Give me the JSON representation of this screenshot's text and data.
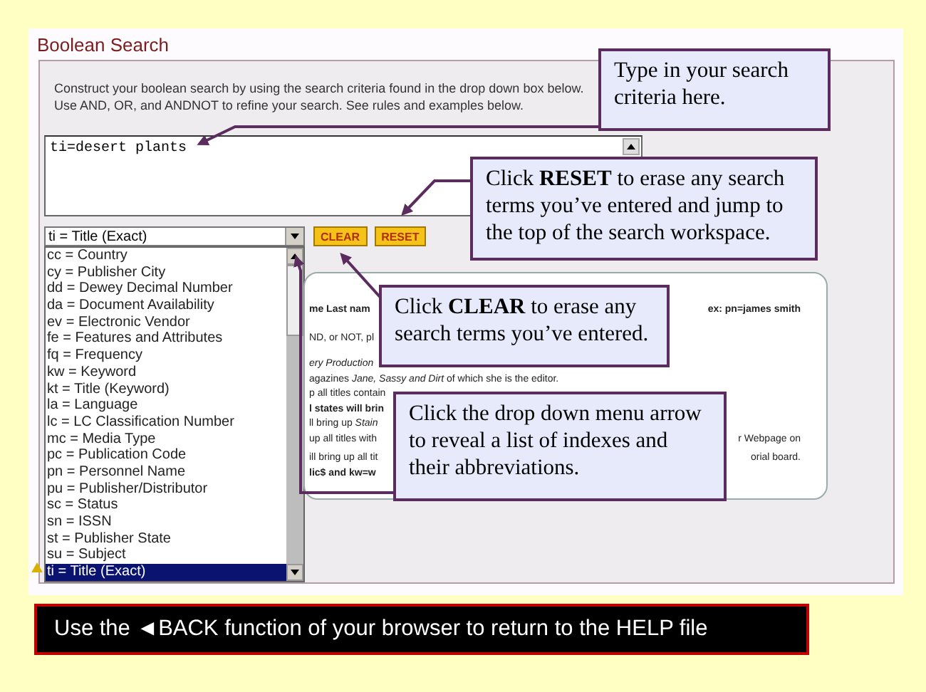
{
  "page": {
    "title": "Boolean Search",
    "instructions": [
      "Construct your boolean search by using the search criteria found in the drop down box below.",
      "Use AND, OR, and ANDNOT to refine your search. See rules and examples below."
    ],
    "query": "ti=desert plants",
    "index_select": {
      "value": "ti = Title (Exact)",
      "expanded": true
    },
    "buttons": [
      {
        "label": "CLEAR"
      },
      {
        "label": "RESET"
      }
    ],
    "index_options": [
      {
        "label": "cc = Country",
        "selected": false
      },
      {
        "label": "cy = Publisher City",
        "selected": false
      },
      {
        "label": "dd = Dewey Decimal Number",
        "selected": false
      },
      {
        "label": "da = Document Availability",
        "selected": false
      },
      {
        "label": "ev = Electronic Vendor",
        "selected": false
      },
      {
        "label": "fe = Features and Attributes",
        "selected": false
      },
      {
        "label": "fq = Frequency",
        "selected": false
      },
      {
        "label": "kw = Keyword",
        "selected": false
      },
      {
        "label": "kt = Title (Keyword)",
        "selected": false
      },
      {
        "label": "la = Language",
        "selected": false
      },
      {
        "label": "lc = LC Classification Number",
        "selected": false
      },
      {
        "label": "mc = Media Type",
        "selected": false
      },
      {
        "label": "pc = Publication Code",
        "selected": false
      },
      {
        "label": "pn = Personnel Name",
        "selected": false
      },
      {
        "label": "pu = Publisher/Distributor",
        "selected": false
      },
      {
        "label": "sc = Status",
        "selected": false
      },
      {
        "label": "sn = ISSN",
        "selected": false
      },
      {
        "label": "st = Publisher State",
        "selected": false
      },
      {
        "label": "su = Subject",
        "selected": false
      },
      {
        "label": "ti = Title (Exact)",
        "selected": true
      }
    ],
    "examples": [
      {
        "left": "me Last nam",
        "right": "ex: pn=james smith",
        "kind": "bold"
      },
      {
        "left": "ND, or NOT, pl",
        "kind": "plain"
      },
      {
        "left": "ery Production",
        "kind": "italic"
      },
      {
        "left": "agazines *Jane, Sassy and Dirt* of which she is the editor.",
        "kind": "plain"
      },
      {
        "left": "p all titles contain",
        "kind": "plain"
      },
      {
        "left": "l states will brin",
        "kind": "bold"
      },
      {
        "left": "ll bring up *Stain*",
        "kind": "plain"
      },
      {
        "left": "up all titles with",
        "right": "r Webpage on",
        "kind": "plain"
      },
      {
        "left": "ill bring up all tit",
        "right": "orial board.",
        "kind": "plain"
      },
      {
        "left": "lic$ and kw=w",
        "kind": "bold"
      }
    ]
  },
  "callouts": [
    {
      "text": "Type in your search criteria here."
    },
    {
      "text": "Click **RESET** to erase any search terms you’ve entered and jump to the top of the search workspace."
    },
    {
      "text": "Click **CLEAR** to erase any search terms you’ve entered."
    },
    {
      "text": "Click the drop down menu arrow to reveal a list of indexes and their abbreviations."
    }
  ],
  "footer": "Use the ◄BACK function of your browser to return to the HELP file"
}
